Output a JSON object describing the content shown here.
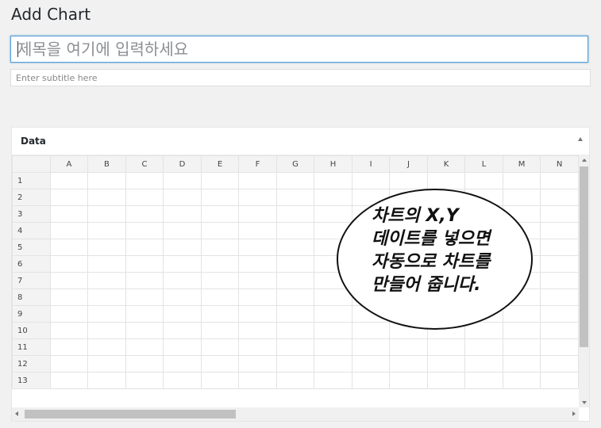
{
  "page": {
    "title": "Add Chart"
  },
  "title_input": {
    "placeholder": "제목을 여기에 입력하세요",
    "value": ""
  },
  "subtitle_input": {
    "placeholder": "Enter subtitle here",
    "value": ""
  },
  "data_panel": {
    "title": "Data",
    "columns": [
      "A",
      "B",
      "C",
      "D",
      "E",
      "F",
      "G",
      "H",
      "I",
      "J",
      "K",
      "L",
      "M",
      "N"
    ],
    "rows": [
      "1",
      "2",
      "3",
      "4",
      "5",
      "6",
      "7",
      "8",
      "9",
      "10",
      "11",
      "12",
      "13"
    ]
  },
  "callout": {
    "lines": [
      "차트의 X,Y",
      "데이트를 넣으면",
      "자동으로 차트를",
      "만들어 줍니다."
    ]
  },
  "colors": {
    "accent": "#5b9dd9",
    "background": "#f1f1f1",
    "grid_border": "#e3e3e3"
  }
}
